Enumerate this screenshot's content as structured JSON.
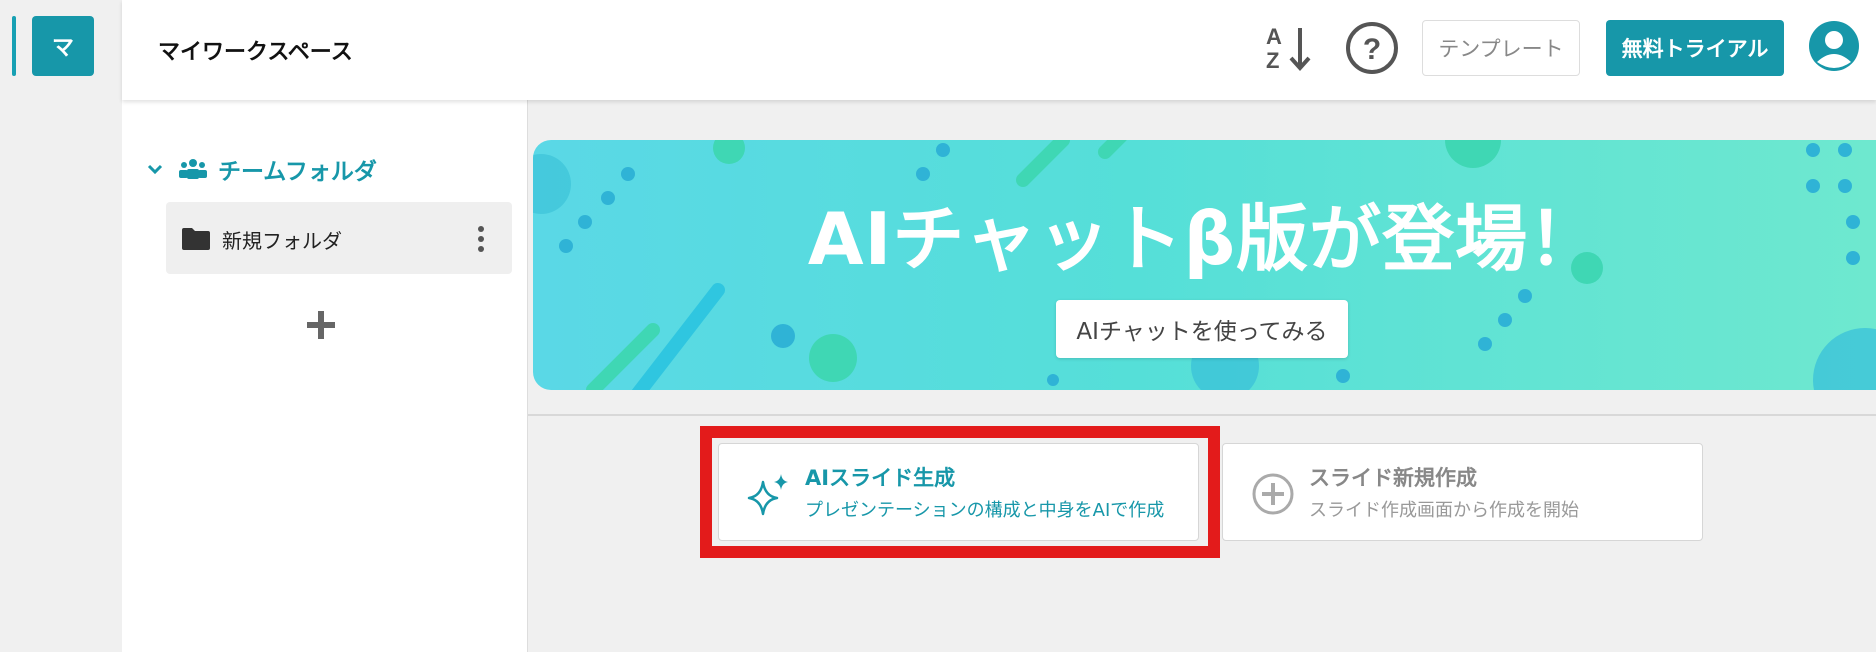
{
  "workspace": {
    "badge": "マ"
  },
  "header": {
    "title": "マイワークスペース",
    "template_label": "テンプレート",
    "trial_label": "無料トライアル"
  },
  "sidebar": {
    "team_folder_label": "チームフォルダ",
    "folders": [
      {
        "label": "新規フォルダ"
      }
    ]
  },
  "banner": {
    "title": "AIチャットβ版が登場！",
    "button_label": "AIチャットを使ってみる"
  },
  "actions": {
    "ai": {
      "title": "AIスライド生成",
      "subtitle": "プレゼンテーションの構成と中身をAIで作成"
    },
    "new": {
      "title": "スライド新規作成",
      "subtitle": "スライド作成画面から作成を開始"
    }
  },
  "colors": {
    "accent": "#1797a9",
    "highlight": "#e31b1b",
    "banner_start": "#5ad8e6",
    "banner_end": "#6ee8cf"
  },
  "icons": [
    "sort-az-icon",
    "help-icon",
    "avatar-icon",
    "chevron-down-icon",
    "team-icon",
    "folder-icon",
    "more-vertical-icon",
    "plus-icon",
    "sparkle-icon",
    "plus-circle-icon"
  ]
}
